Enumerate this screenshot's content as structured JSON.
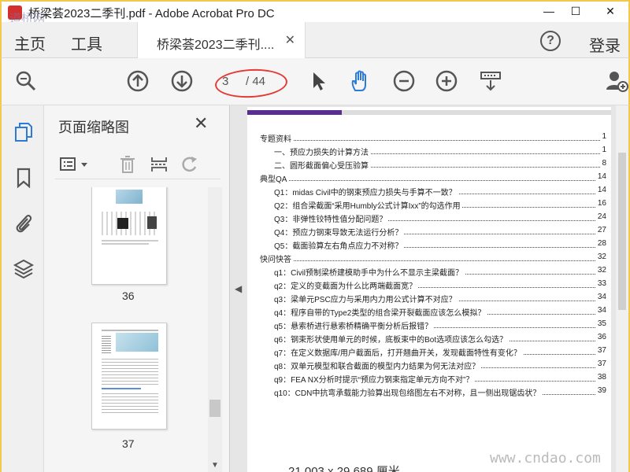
{
  "window": {
    "title": "桥梁荟2023二季刊.pdf - Adobe Acrobat Pro DC",
    "watermark_top_left": "道桥网",
    "minimize": "—",
    "maximize": "☐",
    "close": "✕"
  },
  "menubar": {
    "home": "主页",
    "tools": "工具",
    "document_tab": "桥梁荟2023二季刊....",
    "tab_close": "✕",
    "help": "?",
    "login": "登录"
  },
  "toolbar": {
    "current_page": "3",
    "page_total": "/ 44",
    "icons": [
      "search-icon",
      "arrow-up-icon",
      "arrow-down-icon",
      "select-arrow-icon",
      "hand-icon",
      "zoom-out-icon",
      "zoom-in-icon",
      "scroll-mode-icon",
      "add-user-icon"
    ],
    "accent_color": "#2d7bd8",
    "annotation_color": "#e53935"
  },
  "thumbnail_panel": {
    "title": "页面缩略图",
    "close": "✕",
    "pages": [
      {
        "number": "36"
      },
      {
        "number": "37"
      }
    ]
  },
  "document": {
    "toc": [
      {
        "level": 0,
        "text": "专题资料",
        "page": "1"
      },
      {
        "level": 1,
        "text": "一、预应力损失的计算方法",
        "page": "1"
      },
      {
        "level": 1,
        "text": "二、圆形截面偏心受压验算",
        "page": "8"
      },
      {
        "level": 0,
        "text": "典型QA",
        "page": "14"
      },
      {
        "level": 1,
        "text": "Q1：midas Civil中的钢束预应力损失与手算不一致？",
        "page": "14"
      },
      {
        "level": 1,
        "text": "Q2：组合梁截面“采用Humbly公式计算Ixx”的勾选作用",
        "page": "16"
      },
      {
        "level": 1,
        "text": "Q3：非弹性铰特性值分配问题？",
        "page": "24"
      },
      {
        "level": 1,
        "text": "Q4：预应力钢束导致无法运行分析？",
        "page": "27"
      },
      {
        "level": 1,
        "text": "Q5：截面验算左右角点应力不对称？",
        "page": "28"
      },
      {
        "level": 0,
        "text": "快问快答",
        "page": "32"
      },
      {
        "level": 1,
        "text": "q1：Civil预制梁桥建模助手中为什么不显示主梁截面？",
        "page": "32"
      },
      {
        "level": 1,
        "text": "q2：定义的变截面为什么比两端截面宽？",
        "page": "33"
      },
      {
        "level": 1,
        "text": "q3：梁单元PSC应力与采用内力用公式计算不对应？",
        "page": "34"
      },
      {
        "level": 1,
        "text": "q4：程序自带的Type2类型的组合梁开裂截面应该怎么模拟？",
        "page": "34"
      },
      {
        "level": 1,
        "text": "q5：悬索桥进行悬索桥精确平衡分析后报错？",
        "page": "35"
      },
      {
        "level": 1,
        "text": "q6：钢束形状使用单元的时候，底板束中的Bot选项应该怎么勾选？",
        "page": "36"
      },
      {
        "level": 1,
        "text": "q7：在定义数据库/用户截面后，打开翘曲开关，发现截面特性有变化？",
        "page": "37"
      },
      {
        "level": 1,
        "text": "q8：双单元模型和联合截面的模型内力结果为何无法对应？",
        "page": "37"
      },
      {
        "level": 1,
        "text": "q9：FEA NX分析时提示“预应力钢束指定单元方向不对”？",
        "page": "38"
      },
      {
        "level": 1,
        "text": "q10：CDN中抗弯承载能力验算出现包络图左右不对称，且一侧出现锯齿状？",
        "page": "39"
      }
    ],
    "page_size": "21.003 x 29.689 厘米",
    "watermark_bottom_right": "www.cndao.com",
    "accent_color": "#5b2d8e"
  }
}
